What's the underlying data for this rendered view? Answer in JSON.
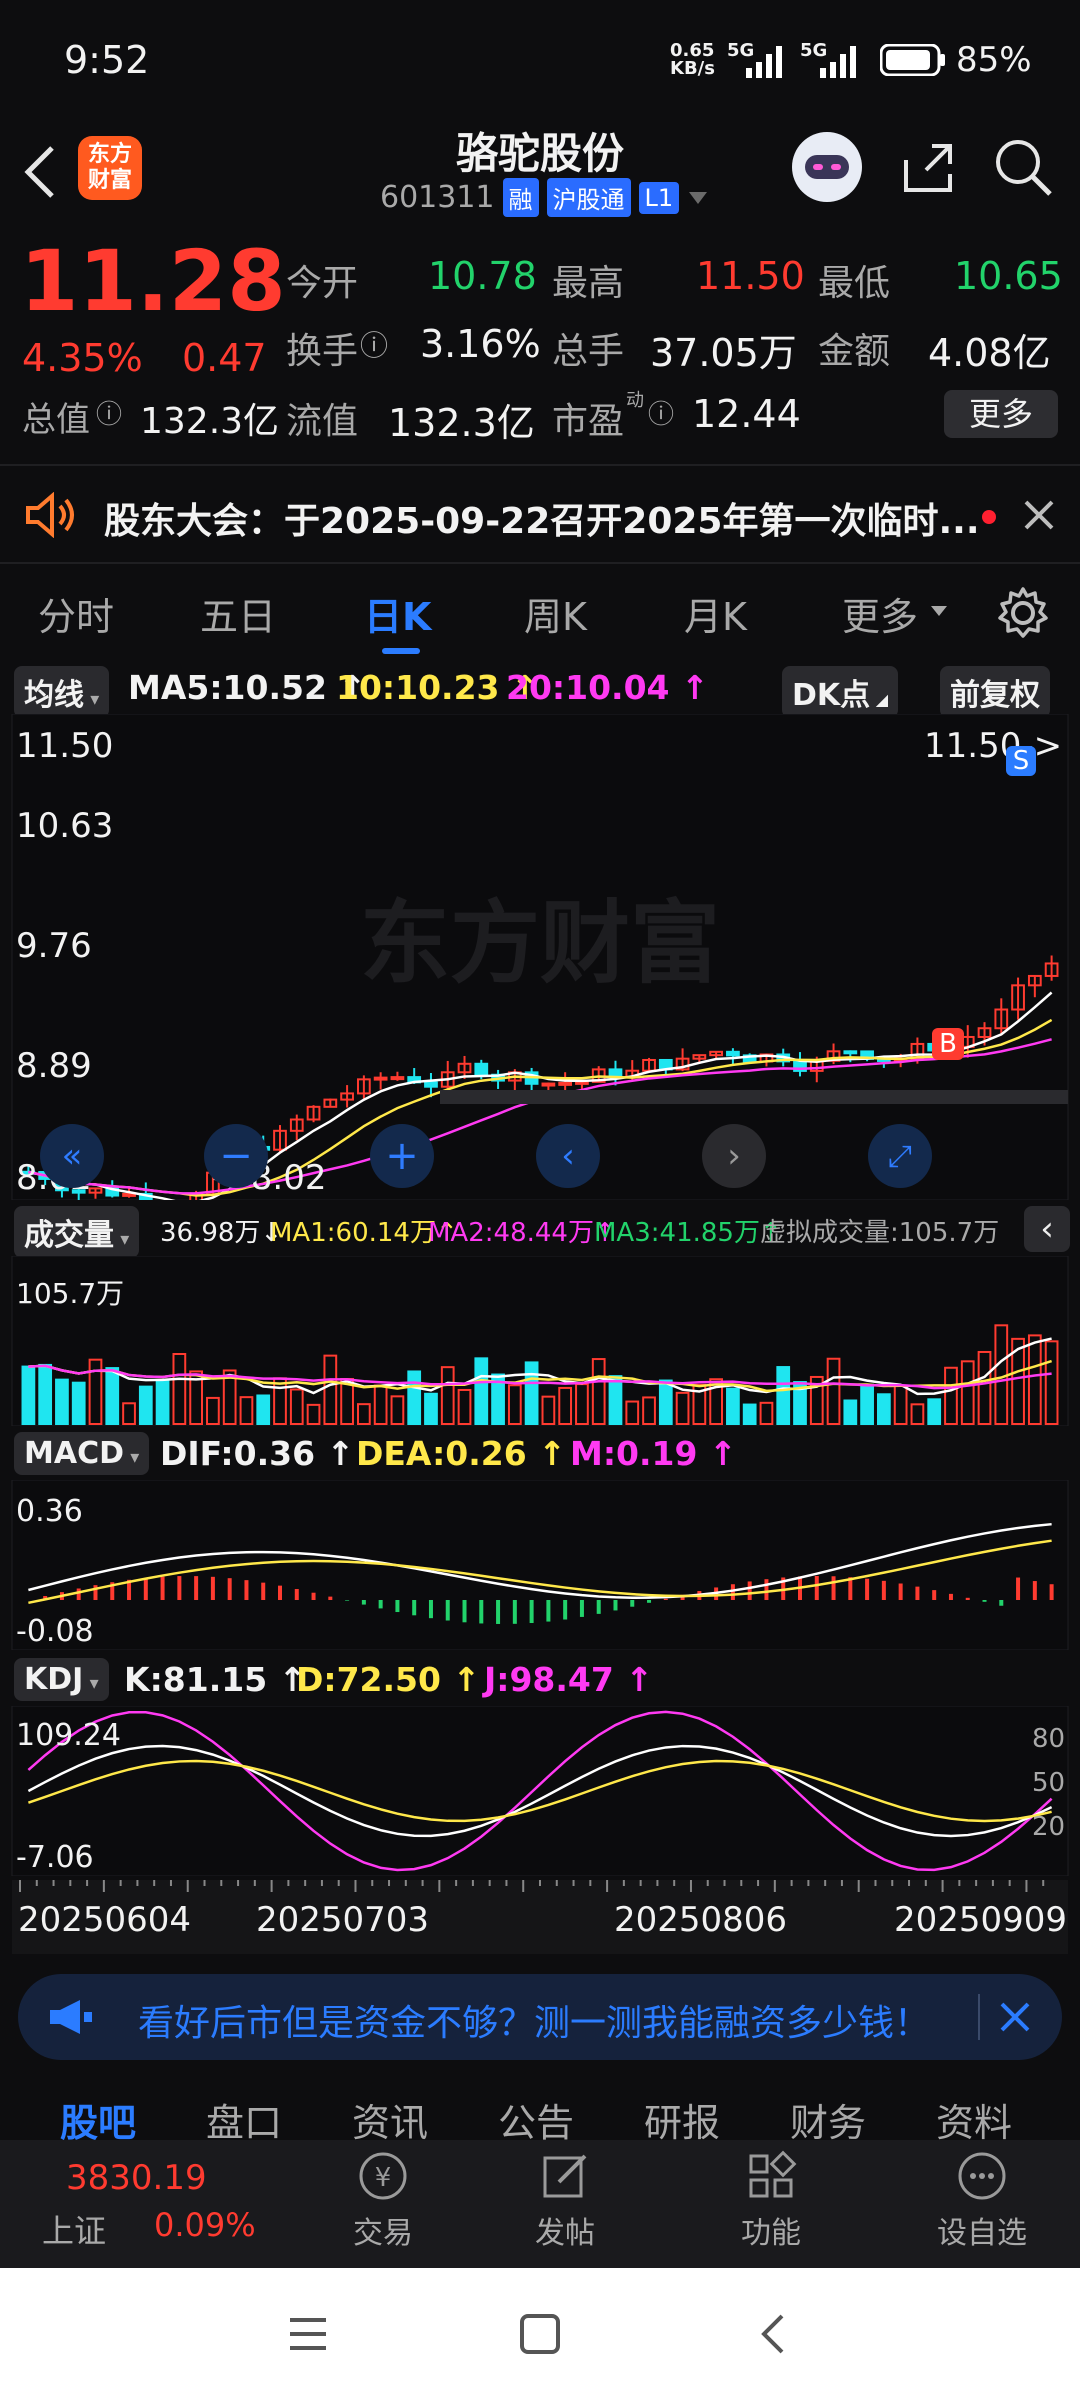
{
  "status_bar": {
    "time": "9:52",
    "net_speed": "0.65\nKB/s",
    "net1": "5G",
    "net2": "5G",
    "battery": "85%"
  },
  "header": {
    "title": "骆驼股份",
    "code": "601311",
    "badge1": "融",
    "badge2": "沪股通",
    "badge3": "L1"
  },
  "quote": {
    "price": "11.28",
    "pct": "4.35%",
    "chg": "0.47",
    "open_label": "今开",
    "open": "10.78",
    "high_label": "最高",
    "high": "11.50",
    "low_label": "最低",
    "low": "10.65",
    "turnover_label": "换手",
    "turnover": "3.16%",
    "volume_label": "总手",
    "volume": "37.05万",
    "amount_label": "金额",
    "amount": "4.08亿",
    "mktcap_label": "总值",
    "mktcap": "132.3亿",
    "float_label": "流值",
    "float": "132.3亿",
    "pe_label": "市盈",
    "pe_sup": "动",
    "pe": "12.44",
    "more": "更多"
  },
  "notice": {
    "text": "股东大会：于2025-09-22召开2025年第一次临时..."
  },
  "period_tabs": [
    "分时",
    "五日",
    "日K",
    "周K",
    "月K",
    "更多"
  ],
  "active_tab": 2,
  "kline": {
    "ma_dropdown": "均线",
    "ma5": "MA5:10.52",
    "ma10": "10:10.23",
    "ma20": "20:10.04",
    "dk": "DK点",
    "fq": "前复权",
    "yticks": [
      "11.50",
      "10.63",
      "9.76",
      "8.89",
      "8.02"
    ],
    "high_mark": "11.50->",
    "low_mark": "<-8.02",
    "sell_marker": "S",
    "buy_marker": "B",
    "watermark": "东方财富"
  },
  "volume": {
    "label": "成交量",
    "v": "36.98万",
    "ma1": "MA1:60.14万",
    "ma2": "MA2:48.44万",
    "ma3": "MA3:41.85万",
    "virtual": "虚拟成交量:105.7万",
    "ymax": "105.7万"
  },
  "macd": {
    "label": "MACD",
    "dif": "DIF:0.36",
    "dea": "DEA:0.26",
    "m": "M:0.19",
    "ytop": "0.36",
    "ybot": "-0.08"
  },
  "kdj": {
    "label": "KDJ",
    "k": "K:81.15",
    "d": "D:72.50",
    "j": "J:98.47",
    "ytop": "109.24",
    "ybot": "-7.06",
    "r80": "80",
    "r50": "50",
    "r20": "20"
  },
  "dates": [
    "20250604",
    "20250703",
    "20250806",
    "20250909"
  ],
  "banner": {
    "text": "看好后市但是资金不够？测一测我能融资多少钱！"
  },
  "bottom_tabs": [
    "股吧",
    "盘口",
    "资讯",
    "公告",
    "研报",
    "财务",
    "资料"
  ],
  "index": {
    "value": "3830.19",
    "name": "上证",
    "pct": "0.09%"
  },
  "actions": [
    "交易",
    "发帖",
    "功能",
    "设自选"
  ]
}
